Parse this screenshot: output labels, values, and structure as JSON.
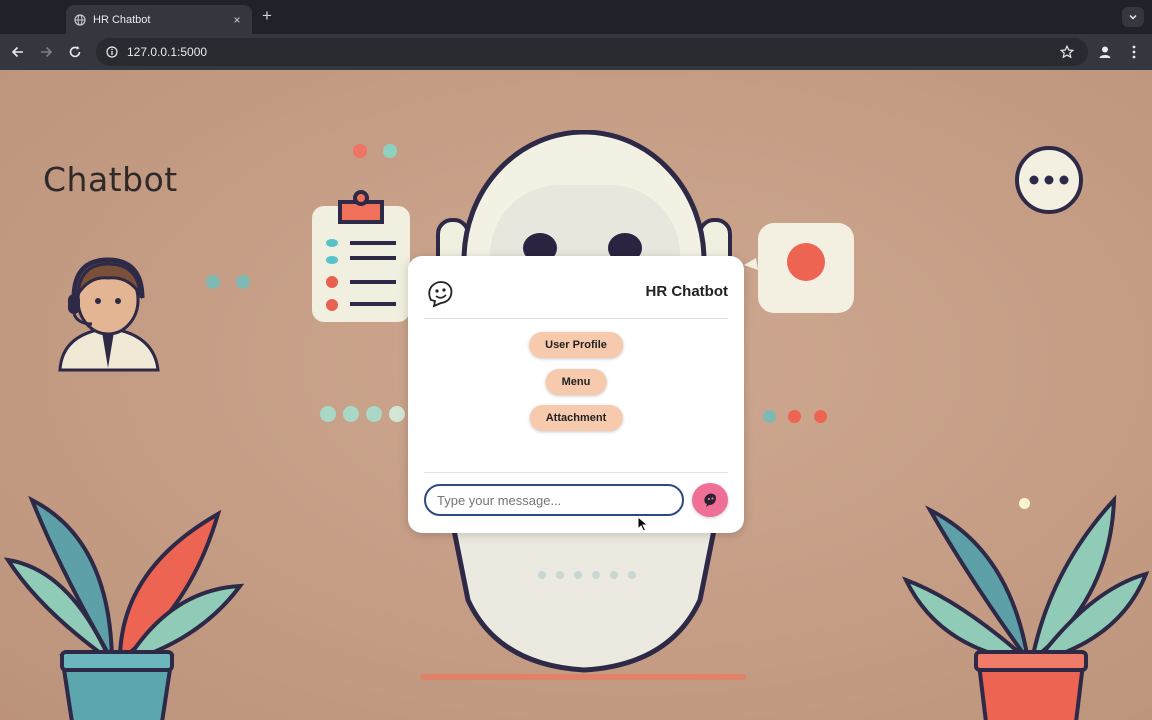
{
  "browser": {
    "tab_title": "HR Chatbot",
    "tab_close": "×",
    "new_tab": "+",
    "url": "127.0.0.1:5000"
  },
  "background": {
    "title": "Chatbot"
  },
  "chat": {
    "title": "HR Chatbot",
    "options": [
      "User Profile",
      "Menu",
      "Attachment"
    ],
    "input_placeholder": "Type your message...",
    "send_color": "#f06f96",
    "option_color": "#f7c9ad",
    "input_border_color": "#2d4a86"
  }
}
